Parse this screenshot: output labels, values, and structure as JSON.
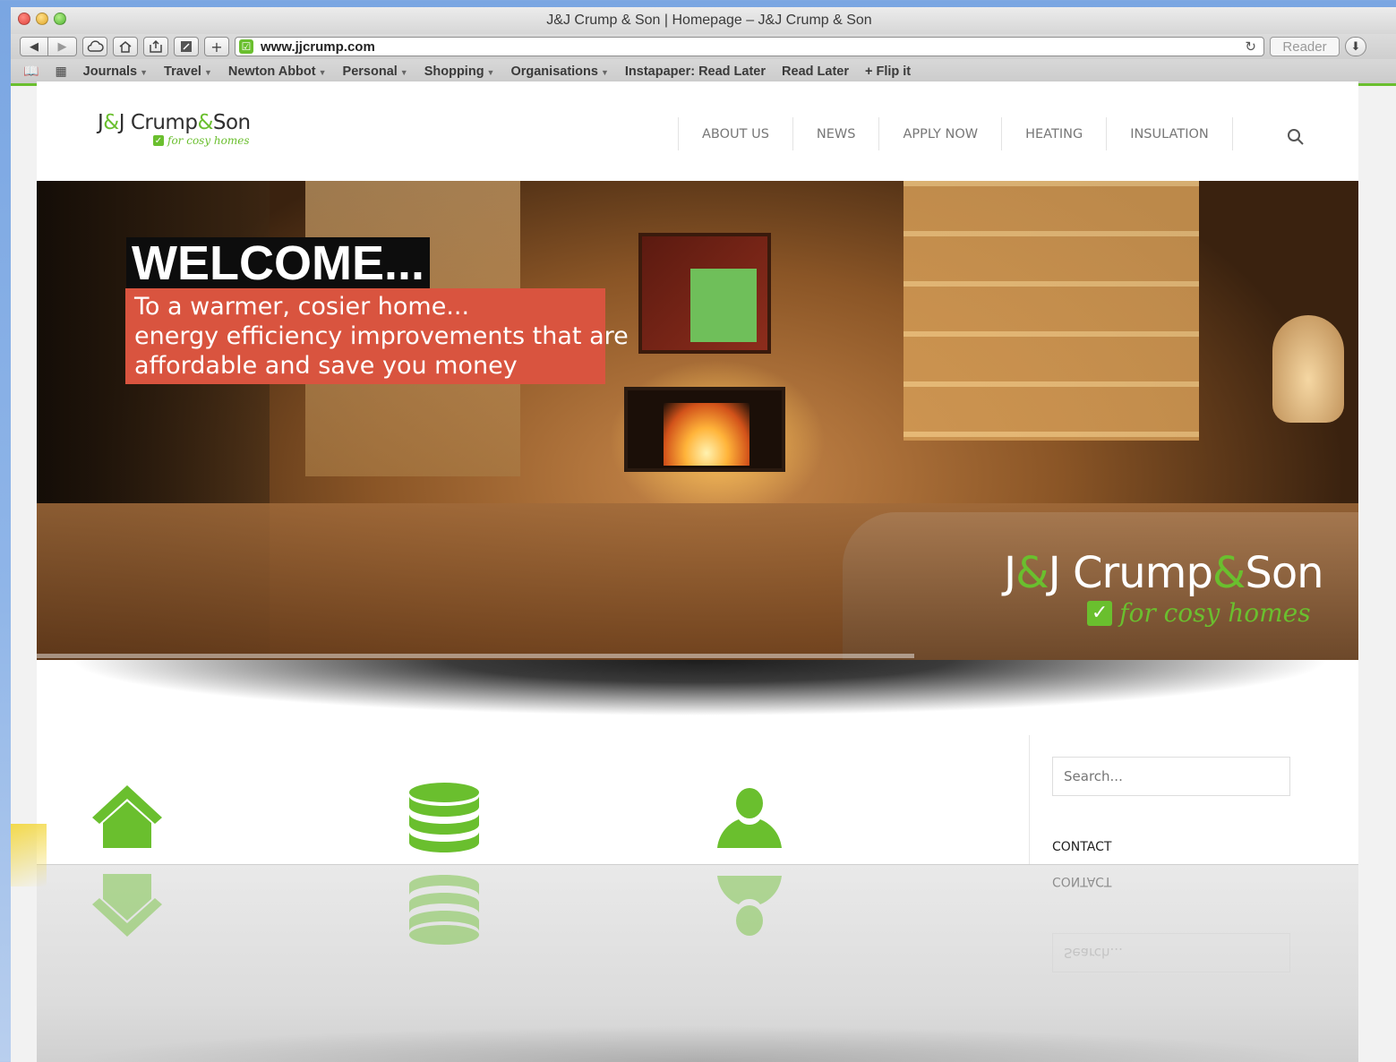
{
  "window": {
    "title": "J&J Crump & Son | Homepage – J&J Crump & Son"
  },
  "toolbar": {
    "url": "www.jjcrump.com",
    "reader_label": "Reader"
  },
  "bookmarks": [
    {
      "label": "Journals",
      "dropdown": true
    },
    {
      "label": "Travel",
      "dropdown": true
    },
    {
      "label": "Newton Abbot",
      "dropdown": true
    },
    {
      "label": "Personal",
      "dropdown": true
    },
    {
      "label": "Shopping",
      "dropdown": true
    },
    {
      "label": "Organisations",
      "dropdown": true
    },
    {
      "label": "Instapaper: Read Later",
      "dropdown": false
    },
    {
      "label": "Read Later",
      "dropdown": false
    },
    {
      "label": "+ Flip it",
      "dropdown": false
    }
  ],
  "site": {
    "logo": {
      "pre": "J",
      "amp1": "&",
      "mid": "J Crump",
      "amp2": "&",
      "post": "Son",
      "tagline": "for cosy homes"
    },
    "nav": [
      "ABOUT US",
      "NEWS",
      "APPLY NOW",
      "HEATING",
      "INSULATION"
    ],
    "hero": {
      "heading": "WELCOME...",
      "lines": [
        "To a warmer, cosier home...",
        "energy efficiency improvements that are",
        "affordable and save you money"
      ]
    },
    "sidebar": {
      "search_placeholder": "Search...",
      "contact_heading": "CONTACT"
    }
  },
  "colors": {
    "brand_green": "#6abf2e",
    "tagline_red": "#d9543f"
  },
  "icons": [
    "house-icon",
    "database-icon",
    "person-icon",
    "search-icon"
  ]
}
